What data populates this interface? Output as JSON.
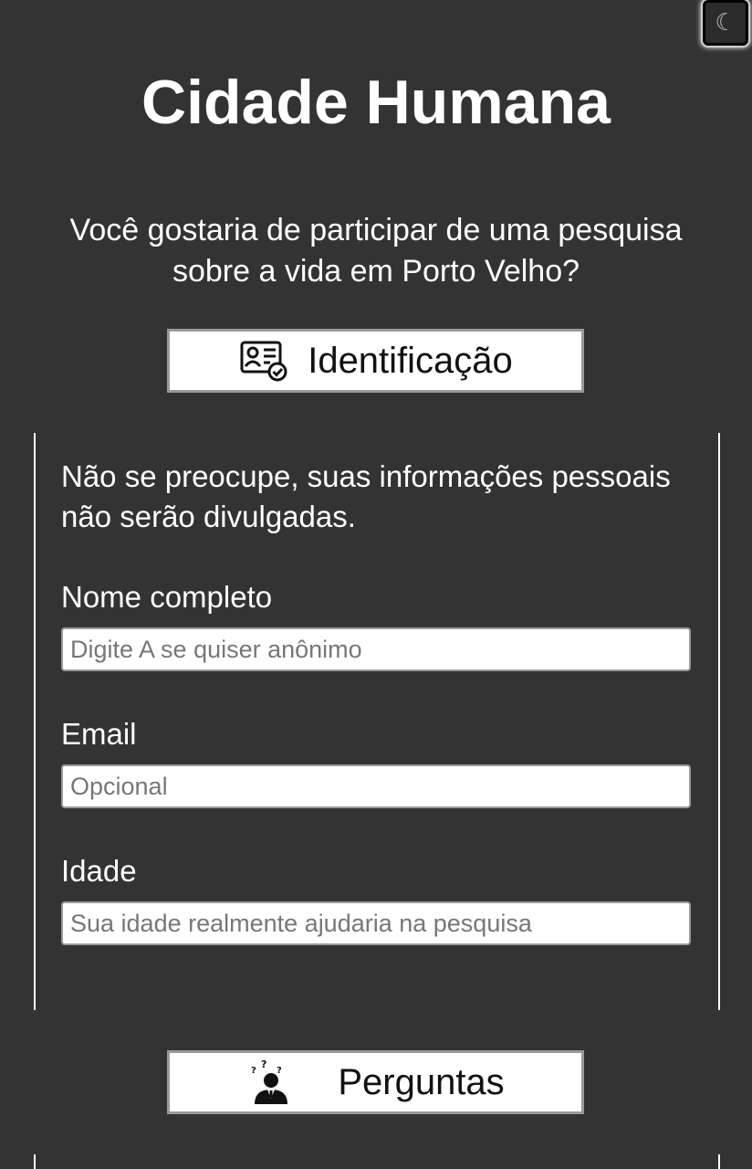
{
  "header": {
    "theme_toggle_glyph": "☾",
    "title": "Cidade Humana"
  },
  "intro": {
    "text": "Você gostaria de participar de uma pesquisa sobre a vida em Porto Velho?"
  },
  "sections": {
    "identificacao_label": "Identificação",
    "identificacao_icon": "id-card-check-icon",
    "perguntas_label": "Perguntas",
    "perguntas_icon": "confused-person-icon"
  },
  "form": {
    "notice": "Não se preocupe, suas informações pessoais não serão divulgadas.",
    "name": {
      "label": "Nome completo",
      "value": "",
      "placeholder": "Digite A se quiser anônimo"
    },
    "email": {
      "label": "Email",
      "value": "",
      "placeholder": "Opcional"
    },
    "age": {
      "label": "Idade",
      "value": "",
      "placeholder": "Sua idade realmente ajudaria na pesquisa"
    }
  },
  "colors": {
    "background": "#333333",
    "text": "#ffffff",
    "button_background": "#ffffff",
    "button_border": "#9a9a9a"
  }
}
